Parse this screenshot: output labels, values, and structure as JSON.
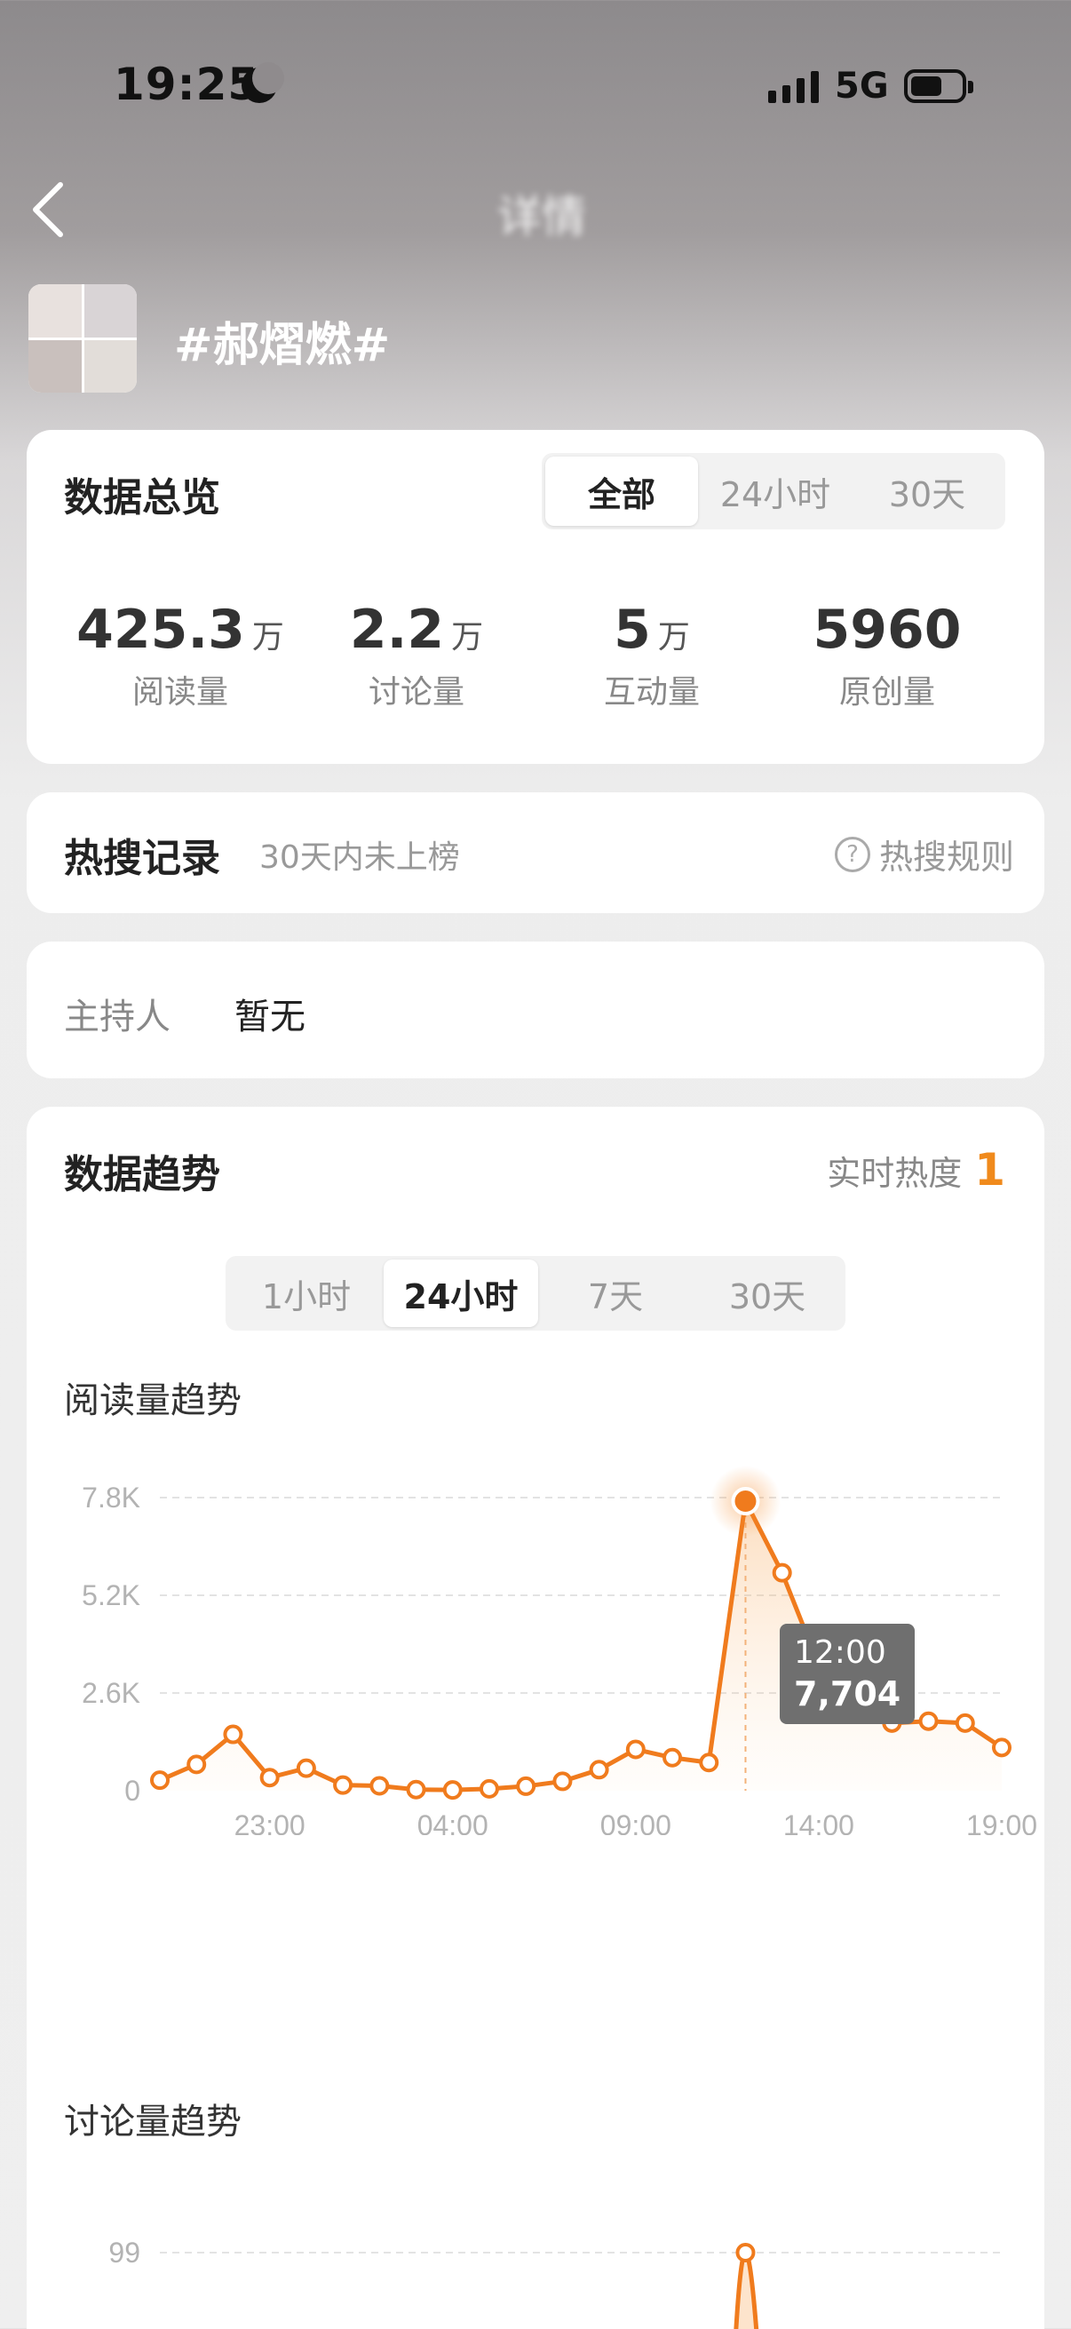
{
  "status_bar": {
    "time": "19:25",
    "network": "5G"
  },
  "nav": {
    "title": "详情"
  },
  "topic": {
    "title": "#郝熠燃#"
  },
  "overview": {
    "title": "数据总览",
    "tabs": [
      "全部",
      "24小时",
      "30天"
    ],
    "active_tab": "全部",
    "stats": [
      {
        "value": "425.3",
        "unit": "万",
        "label": "阅读量"
      },
      {
        "value": "2.2",
        "unit": "万",
        "label": "讨论量"
      },
      {
        "value": "5",
        "unit": "万",
        "label": "互动量"
      },
      {
        "value": "5960",
        "unit": "",
        "label": "原创量"
      }
    ]
  },
  "hot_search": {
    "title": "热搜记录",
    "note": "30天内未上榜",
    "rule_label": "热搜规则"
  },
  "host": {
    "label": "主持人",
    "value": "暂无"
  },
  "trend": {
    "title": "数据趋势",
    "realtime_label": "实时热度",
    "realtime_value": "1",
    "tabs": [
      "1小时",
      "24小时",
      "7天",
      "30天"
    ],
    "active_tab": "24小时",
    "read_section_label": "阅读量趋势",
    "discussion_section_label": "讨论量趋势"
  },
  "chart_data": [
    {
      "type": "line",
      "title": "阅读量趋势",
      "x_ticks": [
        "23:00",
        "04:00",
        "09:00",
        "14:00",
        "19:00"
      ],
      "y_ticks": [
        "0",
        "2.6K",
        "5.2K",
        "7.8K"
      ],
      "ylim": [
        0,
        7800
      ],
      "x": [
        "20:00",
        "21:00",
        "22:00",
        "23:00",
        "00:00",
        "01:00",
        "02:00",
        "03:00",
        "04:00",
        "05:00",
        "06:00",
        "07:00",
        "08:00",
        "09:00",
        "10:00",
        "11:00",
        "12:00",
        "13:00",
        "14:00",
        "15:00",
        "16:00",
        "17:00",
        "18:00",
        "19:00"
      ],
      "values": [
        280,
        700,
        1500,
        350,
        600,
        150,
        130,
        30,
        20,
        50,
        120,
        250,
        560,
        1100,
        880,
        750,
        7704,
        5800,
        3350,
        2600,
        1800,
        1850,
        1800,
        1150
      ],
      "highlight": {
        "x": "12:00",
        "value": "7,704"
      },
      "color": "#f07b1d",
      "grid": true
    },
    {
      "type": "line",
      "title": "讨论量趋势",
      "y_ticks": [
        "99"
      ],
      "partial": true,
      "peak_x": "12:00",
      "peak_value": 99,
      "color": "#f07b1d"
    }
  ],
  "colors": {
    "accent": "#f07b1d",
    "realtime": "#f08a1c"
  }
}
